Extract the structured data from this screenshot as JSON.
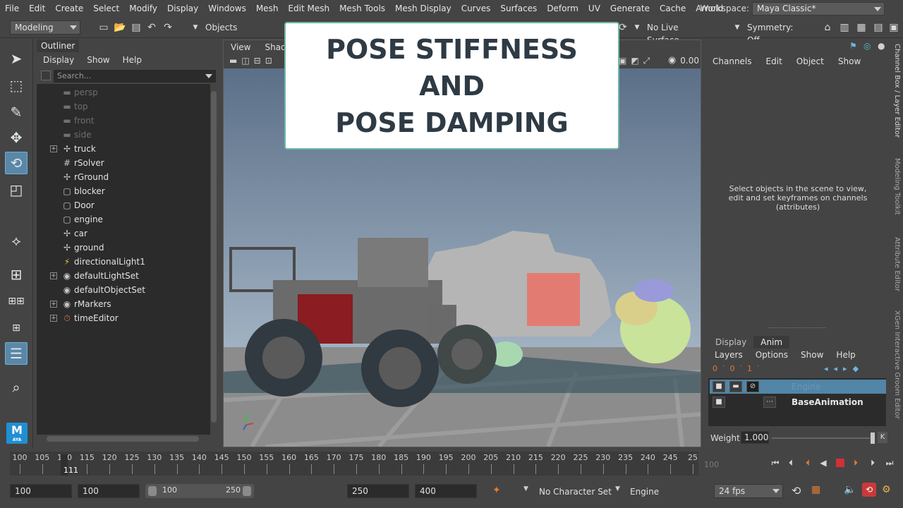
{
  "menu": [
    "File",
    "Edit",
    "Create",
    "Select",
    "Modify",
    "Display",
    "Windows",
    "Mesh",
    "Edit Mesh",
    "Mesh Tools",
    "Mesh Display",
    "Curves",
    "Surfaces",
    "Deform",
    "UV",
    "Generate",
    "Cache",
    "Arnold"
  ],
  "workspace": {
    "label": "Workspace:",
    "value": "Maya Classic*"
  },
  "statusline": {
    "menuset": "Modeling",
    "objects": "Objects",
    "live_surface": "No Live Surface",
    "symmetry": "Symmetry: Off"
  },
  "outliner": {
    "tab": "Outliner",
    "menu": [
      "Display",
      "Show",
      "Help"
    ],
    "search_placeholder": "Search...",
    "items": [
      {
        "label": "persp",
        "dim": true,
        "expand": false,
        "icon": "camera-icon"
      },
      {
        "label": "top",
        "dim": true,
        "expand": false,
        "icon": "camera-icon"
      },
      {
        "label": "front",
        "dim": true,
        "expand": false,
        "icon": "camera-icon"
      },
      {
        "label": "side",
        "dim": true,
        "expand": false,
        "icon": "camera-icon"
      },
      {
        "label": "truck",
        "dim": false,
        "expand": true,
        "icon": "transform-icon"
      },
      {
        "label": "rSolver",
        "dim": false,
        "expand": false,
        "icon": "solver-icon"
      },
      {
        "label": "rGround",
        "dim": false,
        "expand": false,
        "icon": "transform-icon"
      },
      {
        "label": "blocker",
        "dim": false,
        "expand": false,
        "icon": "mesh-icon"
      },
      {
        "label": "Door",
        "dim": false,
        "expand": false,
        "icon": "mesh-icon"
      },
      {
        "label": "engine",
        "dim": false,
        "expand": false,
        "icon": "mesh-icon"
      },
      {
        "label": "car",
        "dim": false,
        "expand": false,
        "icon": "transform-icon"
      },
      {
        "label": "ground",
        "dim": false,
        "expand": false,
        "icon": "transform-icon"
      },
      {
        "label": "directionalLight1",
        "dim": false,
        "expand": false,
        "icon": "light-icon"
      },
      {
        "label": "defaultLightSet",
        "dim": false,
        "expand": true,
        "icon": "set-icon"
      },
      {
        "label": "defaultObjectSet",
        "dim": false,
        "expand": false,
        "icon": "set-icon"
      },
      {
        "label": "rMarkers",
        "dim": false,
        "expand": true,
        "icon": "set-icon"
      },
      {
        "label": "timeEditor",
        "dim": false,
        "expand": true,
        "icon": "time-editor-icon"
      }
    ]
  },
  "viewport": {
    "menu": [
      "View",
      "Shadin"
    ],
    "zoom": "0.00"
  },
  "title_card": {
    "lines": [
      "POSE STIFFNESS",
      "AND",
      "POSE DAMPING"
    ]
  },
  "channelbox": {
    "menu": [
      "Channels",
      "Edit",
      "Object",
      "Show"
    ],
    "message": "Select objects in the scene to view, edit and set keyframes on channels (attributes)"
  },
  "side_tabs": [
    "Channel Box / Layer Editor",
    "Modeling Toolkit",
    "Attribute Editor",
    "XGen Interactive Groom Editor"
  ],
  "layereditor": {
    "tabs": [
      "Display",
      "Anim"
    ],
    "menu": [
      "Layers",
      "Options",
      "Show",
      "Help"
    ],
    "layers": [
      {
        "name": "Engine",
        "selected": true
      },
      {
        "name": "BaseAnimation",
        "selected": false
      }
    ],
    "weight_label": "Weight",
    "weight_value": "1.000",
    "weight_key": "K"
  },
  "timeslider": {
    "ticks": [
      "100",
      "105",
      "110",
      "115",
      "120",
      "125",
      "130",
      "135",
      "140",
      "145",
      "150",
      "155",
      "160",
      "165",
      "170",
      "175",
      "180",
      "185",
      "190",
      "195",
      "200",
      "205",
      "210",
      "215",
      "220",
      "225",
      "230",
      "235",
      "240",
      "245",
      "25"
    ],
    "current_frame": "111",
    "frame_field": "100"
  },
  "rangeslider": {
    "start": "100",
    "playback_start": "100",
    "range_start": "100",
    "range_end": "250",
    "playback_end": "250",
    "end": "400",
    "character_set": "No Character Set",
    "anim_layer": "Engine",
    "fps": "24 fps"
  },
  "colors": {
    "accent": "#5285a6",
    "title_border": "#6eb7a4",
    "title_text": "#2e3a44",
    "record": "#d0303a"
  }
}
